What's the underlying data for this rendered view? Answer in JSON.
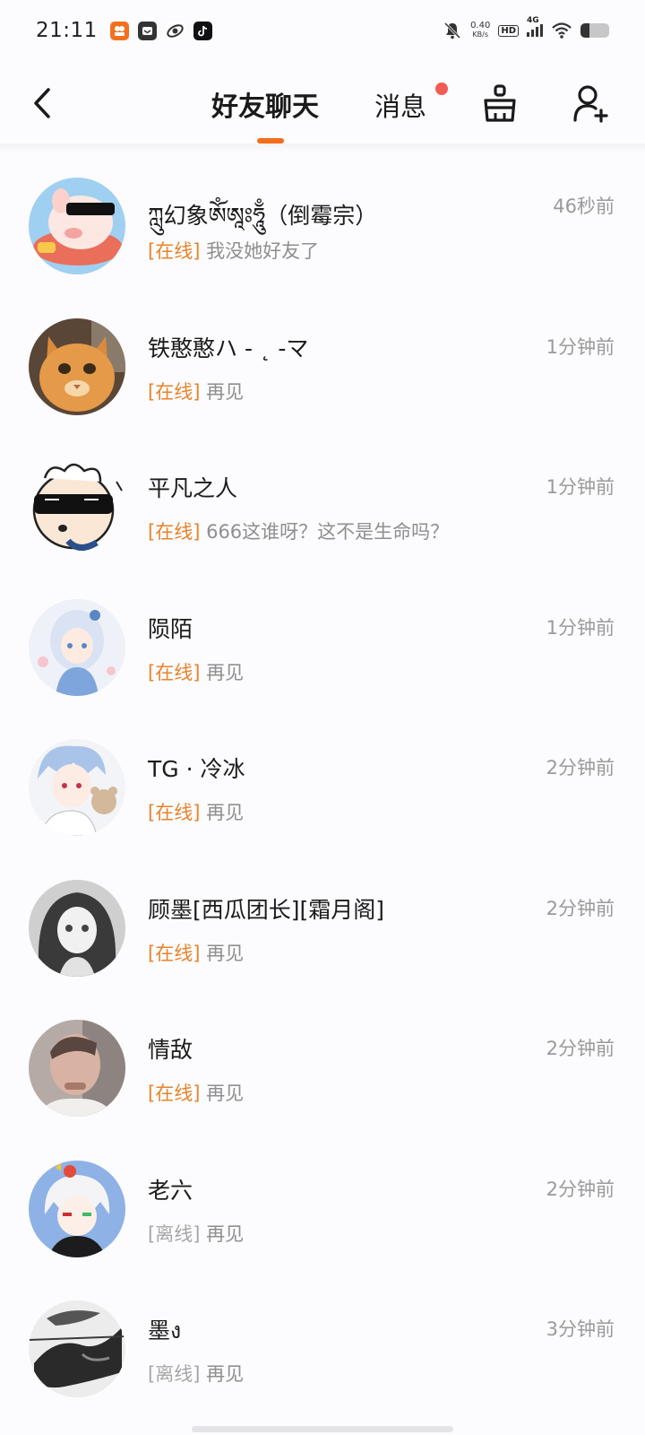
{
  "status_bar": {
    "time": "21:11",
    "netspeed_value": "0.40",
    "netspeed_unit": "KB/s",
    "hd_label": "HD",
    "network_label": "4G",
    "app_icons": [
      "kuaishou-icon",
      "mail-app-icon",
      "browser-app-icon",
      "tiktok-icon"
    ],
    "battery_level": 0.3
  },
  "header": {
    "tab_friends": "好友聊天",
    "tab_messages": "消息",
    "accent_color": "#f46d1b",
    "badge_color": "#f25c54"
  },
  "chats": [
    {
      "name": "ཀླུ幻象ཨོཾཨཱཿཧཱུྃ（倒霉宗）",
      "time": "46秒前",
      "status": "[在线]",
      "online": true,
      "message": "我没她好友了",
      "avatar": "pig-sunglasses-avatar"
    },
    {
      "name": "铁憨憨ハ - ˛ -マ",
      "time": "1分钟前",
      "status": "[在线]",
      "online": true,
      "message": "再见",
      "avatar": "orange-cat-avatar"
    },
    {
      "name": "平凡之人",
      "time": "1分钟前",
      "status": "[在线]",
      "online": true,
      "message": "666这谁呀？这不是生命吗？",
      "avatar": "cartoon-sunglasses-avatar"
    },
    {
      "name": "陨陌",
      "time": "1分钟前",
      "status": "[在线]",
      "online": true,
      "message": "再见",
      "avatar": "anime-girl-blue-avatar"
    },
    {
      "name": "TG · 冷冰",
      "time": "2分钟前",
      "status": "[在线]",
      "online": true,
      "message": "再见",
      "avatar": "anime-boy-bear-avatar"
    },
    {
      "name": "顾墨[西瓜团长][霜月阁]",
      "time": "2分钟前",
      "status": "[在线]",
      "online": true,
      "message": "再见",
      "avatar": "anime-girl-gray-avatar"
    },
    {
      "name": "情敌",
      "time": "2分钟前",
      "status": "[在线]",
      "online": true,
      "message": "再见",
      "avatar": "photo-person-avatar"
    },
    {
      "name": "老六",
      "time": "2分钟前",
      "status": "[离线]",
      "online": false,
      "message": "再见",
      "avatar": "anime-white-hair-avatar"
    },
    {
      "name": "墨ง",
      "time": "3分钟前",
      "status": "[离线]",
      "online": false,
      "message": "再见",
      "avatar": "ink-painting-avatar"
    }
  ]
}
